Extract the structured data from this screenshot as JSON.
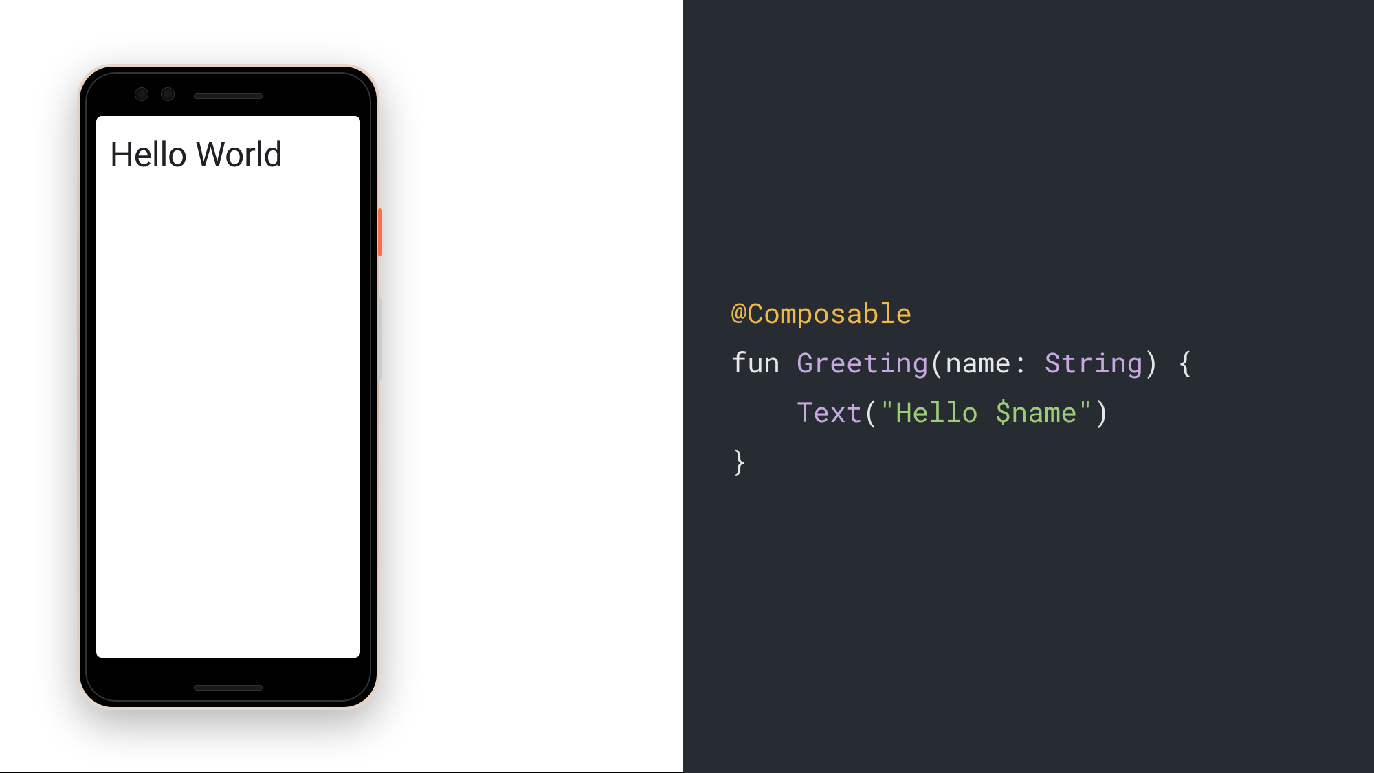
{
  "device": {
    "screen_text": "Hello World"
  },
  "code": {
    "annotation": "@Composable",
    "line2_keyword": "fun ",
    "line2_function": "Greeting",
    "line2_paren_open": "(",
    "line2_param_name": "name",
    "line2_colon": ": ",
    "line2_type": "String",
    "line2_paren_close": ") ",
    "line2_brace": "{",
    "line3_indent": "    ",
    "line3_function": "Text",
    "line3_paren_open": "(",
    "line3_string": "\"Hello $name\"",
    "line3_paren_close": ")",
    "line4": "}"
  }
}
